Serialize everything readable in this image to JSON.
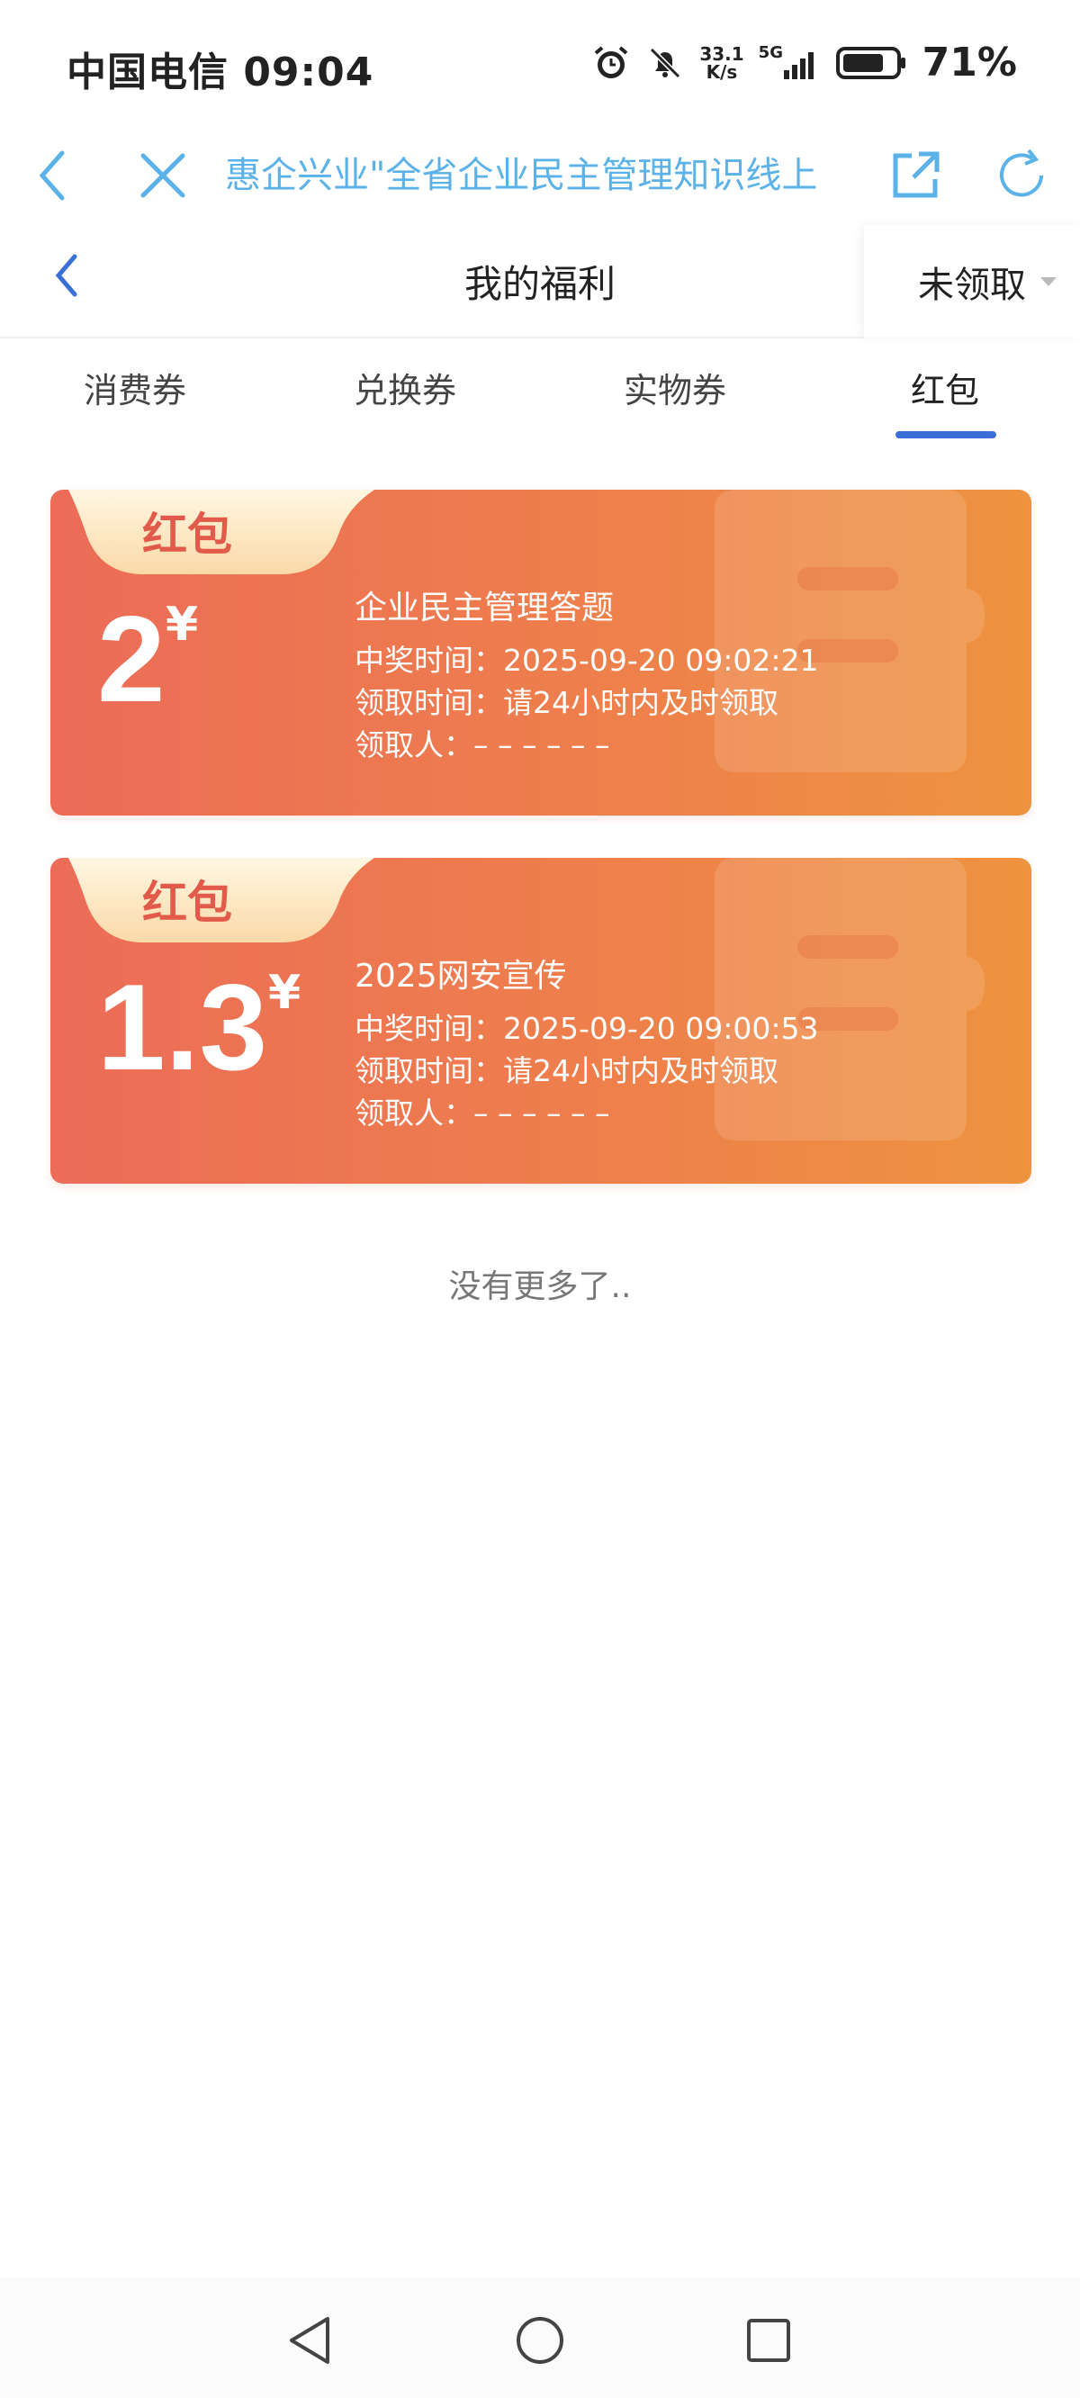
{
  "status_bar": {
    "carrier_time": "中国电信 09:04",
    "net_speed_value": "33.1",
    "net_speed_unit": "K/s",
    "network": "5G",
    "battery": "71%",
    "icons": [
      "alarm-icon",
      "mute-bell-icon",
      "signal-icon",
      "battery-icon"
    ]
  },
  "web_nav": {
    "title": "惠企兴业\"全省企业民主管理知识线上",
    "icons": [
      "back-icon",
      "close-icon",
      "share-icon",
      "refresh-icon"
    ],
    "accent": "#5bb2e8"
  },
  "header": {
    "title": "我的福利",
    "filter_label": "未领取"
  },
  "tabs": [
    {
      "label": "消费券",
      "active": false
    },
    {
      "label": "兑换券",
      "active": false
    },
    {
      "label": "实物券",
      "active": false
    },
    {
      "label": "红包",
      "active": true
    }
  ],
  "cards": [
    {
      "tag": "红包",
      "amount": "2",
      "currency": "¥",
      "name": "企业民主管理答题",
      "win_time": "中奖时间：2025-09-20 09:02:21",
      "claim_time": "领取时间：请24小时内及时领取",
      "claimer": "领取人：– – – – – –"
    },
    {
      "tag": "红包",
      "amount": "1.3",
      "currency": "¥",
      "name": "2025网安宣传",
      "win_time": "中奖时间：2025-09-20 09:00:53",
      "claim_time": "领取时间：请24小时内及时领取",
      "claimer": "领取人：– – – – – –"
    }
  ],
  "footer_text": "没有更多了..",
  "colors": {
    "card_start": "#ec6c58",
    "card_end": "#ee9340",
    "tab_indicator": "#3a6fd8"
  }
}
